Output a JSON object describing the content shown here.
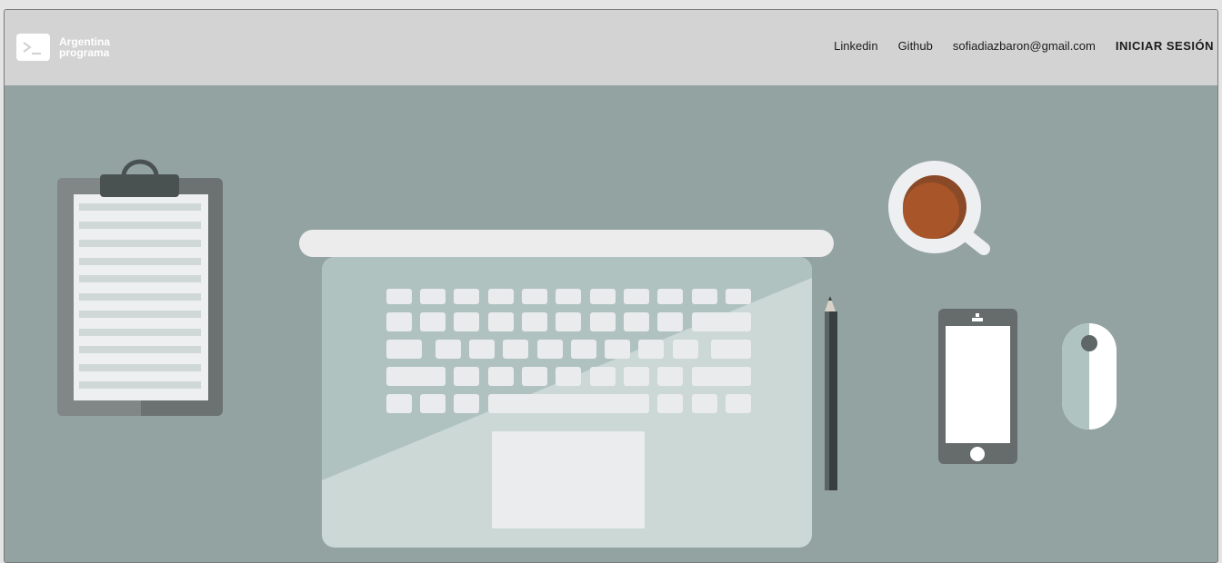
{
  "brand": {
    "line1": "Argentina",
    "line2": "programa",
    "logo_icon": "terminal-icon"
  },
  "nav": {
    "linkedin": "Linkedin",
    "github": "Github",
    "email": "sofiadiazbaron@gmail.com",
    "login": "INICIAR SESIÓN"
  },
  "hero": {
    "illustration": "desk-workspace-illustration",
    "background_color": "#93a3a2"
  }
}
